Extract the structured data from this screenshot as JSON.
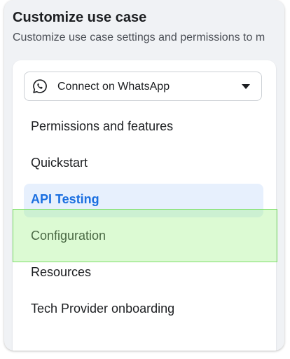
{
  "header": {
    "title": "Customize use case",
    "subtitle": "Customize use case settings and permissions to m"
  },
  "use_case_select": {
    "selected": "Connect on WhatsApp",
    "icon": "whatsapp-icon"
  },
  "nav": {
    "items": [
      {
        "label": "Permissions and features"
      },
      {
        "label": "Quickstart"
      },
      {
        "label": "API Testing",
        "active": true
      },
      {
        "label": "Configuration"
      },
      {
        "label": "Resources"
      },
      {
        "label": "Tech Provider onboarding"
      }
    ]
  },
  "colors": {
    "active_text": "#1b6fe0",
    "active_bg": "#e7f0fd",
    "highlight_border": "#7fe06a"
  }
}
